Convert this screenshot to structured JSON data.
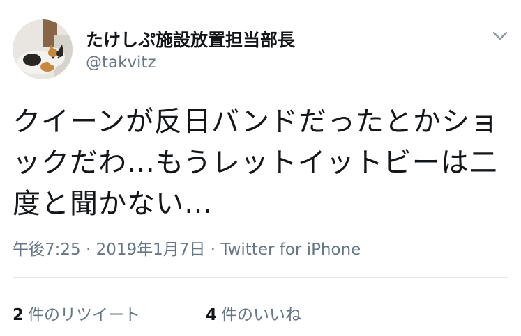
{
  "author": {
    "display_name": "たけしぷ施設放置担当部長",
    "handle": "@takvitz",
    "avatar_icon": "cat-avatar-icon"
  },
  "menu_icon": "chevron-down-icon",
  "tweet": {
    "text": "クイーンが反日バンドだったとかショックだわ…もうレットイットビーは二度と聞かない…",
    "time": "午後7:25",
    "date": "2019年1月7日",
    "source": "Twitter for iPhone",
    "separator": "·"
  },
  "stats": {
    "retweets_count": "2",
    "retweets_label": "件のリツイート",
    "likes_count": "4",
    "likes_label": "件のいいね"
  },
  "colors": {
    "text": "#14171a",
    "secondary": "#657786",
    "divider": "#e1e8ed",
    "background": "#ffffff"
  }
}
